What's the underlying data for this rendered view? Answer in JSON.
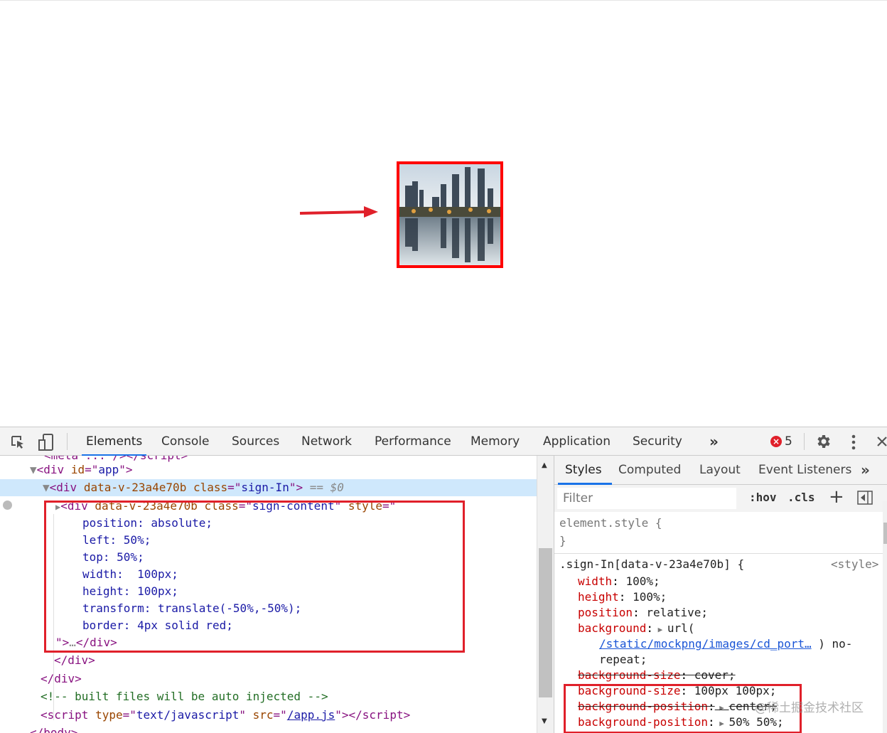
{
  "page": {
    "watermark": "@稀土掘金技术社区"
  },
  "devtools": {
    "tabs": [
      "Elements",
      "Console",
      "Sources",
      "Network",
      "Performance",
      "Memory",
      "Application",
      "Security"
    ],
    "active_tab": "Elements",
    "more_tabs": "»",
    "error_count": "5",
    "icons": [
      "inspect-element-icon",
      "device-toolbar-icon",
      "error-icon",
      "settings-gear-icon",
      "more-vertical-icon",
      "close-icon"
    ]
  },
  "elements": {
    "cut_line": "<meta ... /></script>",
    "lines": {
      "app_open": {
        "lt": "<",
        "tag": "div",
        "attr": "id",
        "eq": "=\"",
        "val": "app",
        "gt": "\">"
      },
      "signin": {
        "lt": "<",
        "tag": "div",
        "attr": "data-v-23a4e70b class",
        "eq": "=\"",
        "val": "sign-In",
        "gt": "\">",
        "sel": " == $0"
      },
      "content": {
        "lt": "<",
        "tag": "div",
        "attr": "data-v-23a4e70b class",
        "eq": "=\"",
        "val": "sign-content",
        "q": "\" ",
        "attr2": "style",
        "eq2": "=\""
      },
      "style_lines": [
        "position: absolute;",
        "left: 50%;",
        "top: 50%;",
        "width:  100px;",
        "height: 100px;",
        "transform: translate(-50%,-50%);",
        "border: 4px solid red;"
      ],
      "content_close": {
        "q": "\">",
        "dots": "…",
        "close": "</div>"
      },
      "close1": "</div>",
      "close2": "</div>",
      "comment": "<!-- built files will be auto injected -->",
      "script": {
        "lt": "<",
        "tag": "script",
        "attr": "type",
        "eq": "=\"",
        "val": "text/javascript",
        "q": "\" ",
        "attr2": "src",
        "eq2": "=\"",
        "link": "/app.js",
        "end": "\"></script>"
      },
      "body_close": "</body>"
    }
  },
  "styles": {
    "subtabs": [
      "Styles",
      "Computed",
      "Layout",
      "Event Listeners"
    ],
    "more": "»",
    "filter_placeholder": "Filter",
    "hov": ":hov",
    "cls": ".cls",
    "plus": "+",
    "element_style_open": "element.style {",
    "element_style_close": "}",
    "rule": {
      "selector": ".sign-In[data-v-23a4e70b] {",
      "source": "<style>",
      "decls": [
        {
          "prop": "width",
          "value": "100%;"
        },
        {
          "prop": "height",
          "value": "100%;"
        },
        {
          "prop": "position",
          "value": "relative;"
        },
        {
          "prop": "background",
          "value": "url("
        }
      ],
      "bg_url": "/static/mockpng/images/cd_port…",
      "bg_rest": ") no-",
      "bg_repeat": "repeat;",
      "overridden": [
        {
          "prop": "background-size",
          "value": "cover;"
        }
      ],
      "highlighted": [
        {
          "prop": "background-size",
          "value": "100px 100px;",
          "struck": false
        },
        {
          "prop": "background-position",
          "value": "center;",
          "struck": true
        },
        {
          "prop": "background-position",
          "value": "50% 50%;",
          "struck": false
        }
      ]
    }
  },
  "colors": {
    "accent": "#1a73e8",
    "highlight_box": "#e0202a",
    "selected_row": "#cfe8fc"
  }
}
